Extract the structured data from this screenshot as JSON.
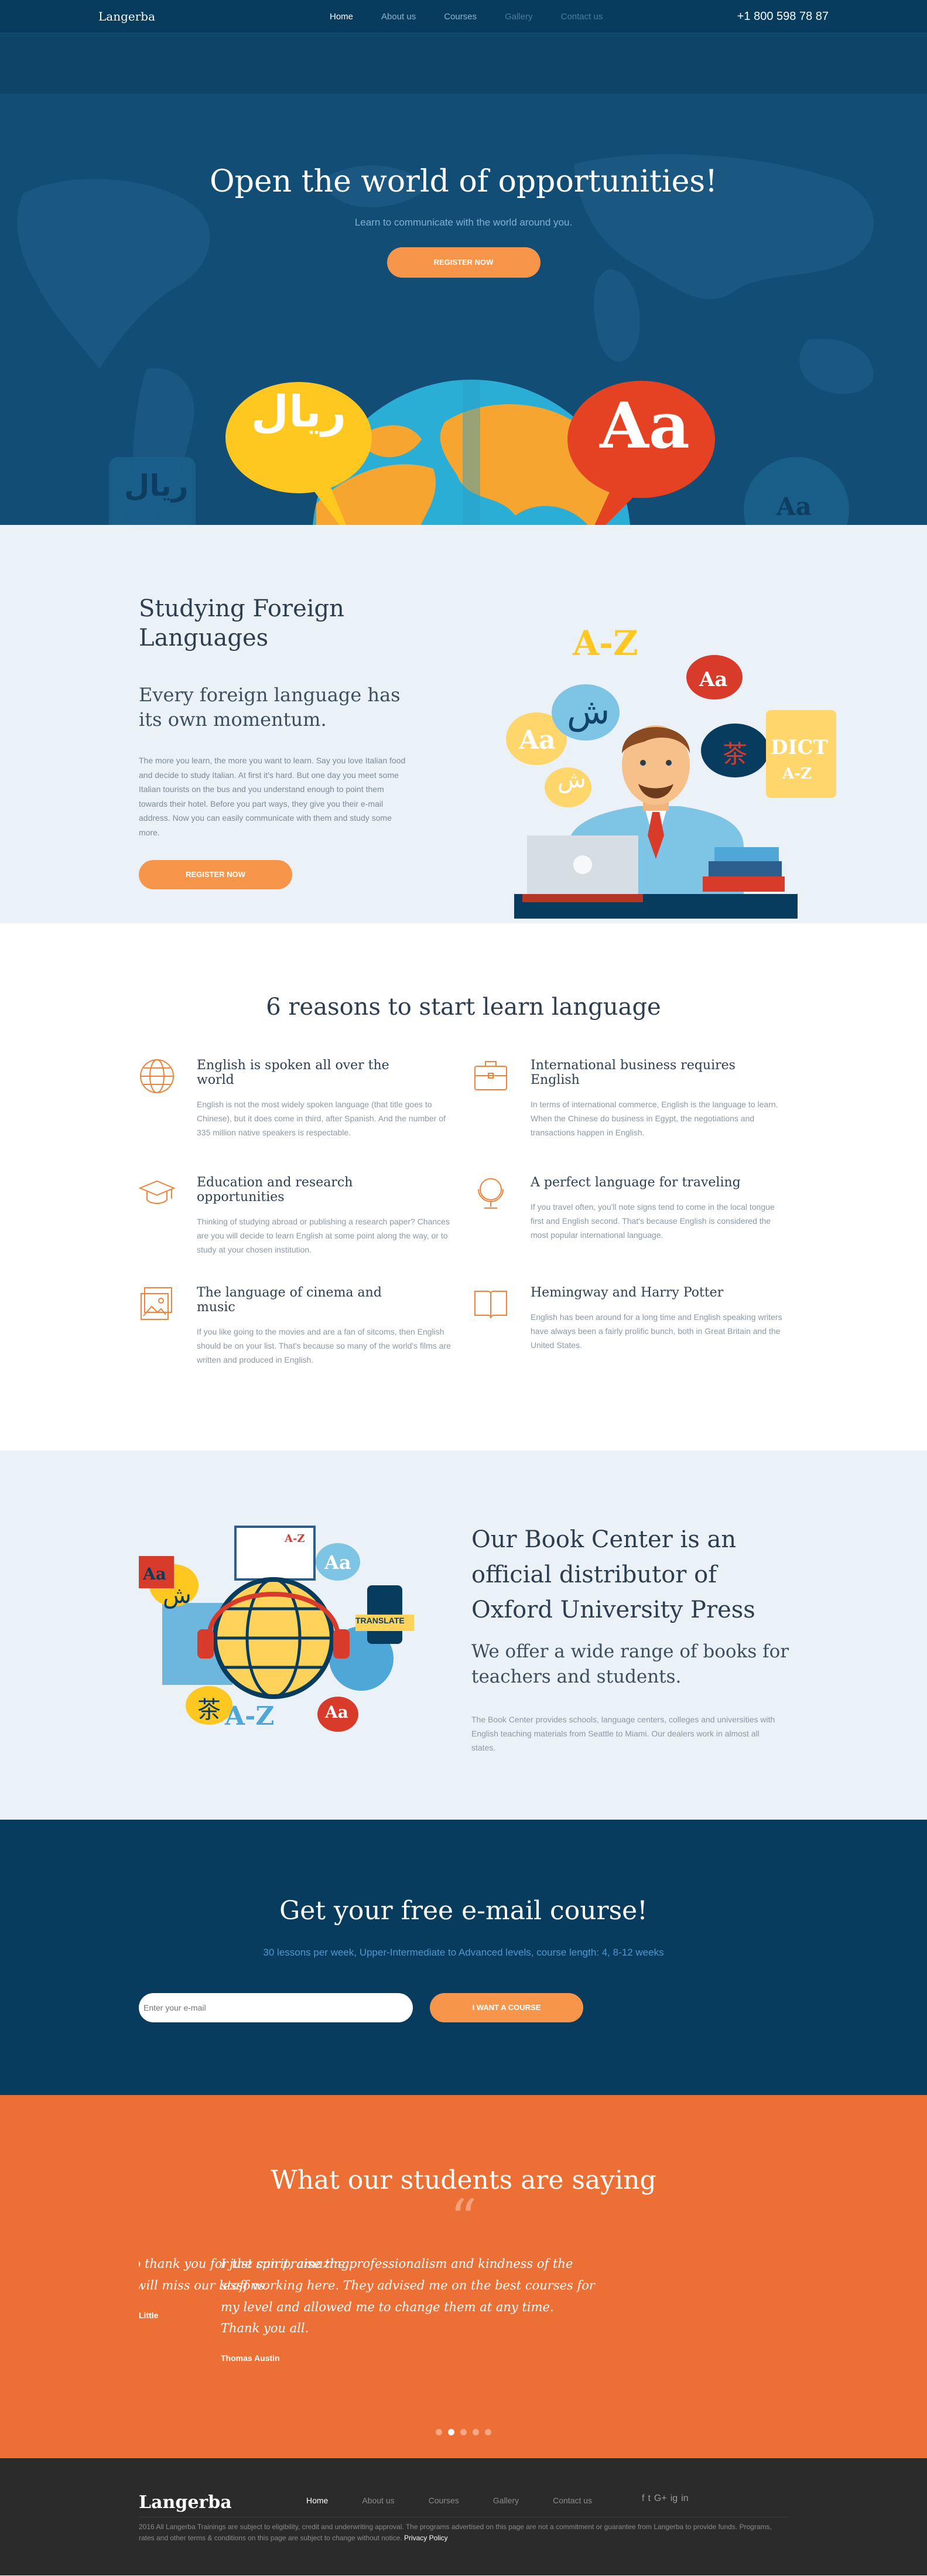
{
  "header": {
    "logo": "Langerba",
    "nav": [
      "Home",
      "About us",
      "Courses",
      "Gallery",
      "Contact us"
    ],
    "phone": "+1 800 598 78 87"
  },
  "hero": {
    "title": "Open the world of opportunities!",
    "subtitle": "Learn to communicate with the world around you.",
    "button": "REGISTER NOW",
    "bubble_left": "ريال",
    "bubble_right": "Aa",
    "bg_glyph_left": "ريال",
    "bg_glyph_right": "Aa"
  },
  "study": {
    "title": "Studying Foreign Languages",
    "subtitle": "Every foreign language has its own momentum.",
    "text": "The more you learn, the more you want to learn. Say you love Italian food and decide to study Italian. At first it's hard. But one day you meet some Italian tourists on the bus and you understand enough to point them towards their hotel. Before you part ways, they give you their e-mail address. Now you can easily communicate with them and study some more.",
    "button": "REGISTER NOW",
    "art_labels": {
      "az": "A-Z",
      "aa_red": "Aa",
      "aa_yellow": "Aa",
      "arabic": "ش",
      "arabic2": "ش",
      "chinese": "茶",
      "dict": "DICT",
      "dict_az": "A-Z"
    }
  },
  "reasons": {
    "title": "6 reasons to start learn language",
    "items": [
      {
        "icon": "globe-icon",
        "title": "English is spoken all over the world",
        "text": "English is not the most widely spoken language (that title goes to Chinese), but it does come in third, after Spanish. And the number of 335 million native speakers is respectable."
      },
      {
        "icon": "briefcase-icon",
        "title": "International business requires English",
        "text": "In terms of international commerce, English is the language to learn. When the Chinese do business in Egypt, the negotiations and transactions happen in English."
      },
      {
        "icon": "graduation-cap-icon",
        "title": "Education and research opportunities",
        "text": "Thinking of studying abroad or publishing a research paper? Chances are you will decide to learn English at some point along the way, or to study at your chosen institution."
      },
      {
        "icon": "globe-stand-icon",
        "title": "A perfect language for traveling",
        "text": "If you travel often, you'll note signs tend to come in the local tongue first and English second. That's because English is considered the most popular international language."
      },
      {
        "icon": "picture-icon",
        "title": "The language of cinema and music",
        "text": "If you like going to the movies and are a fan of sitcoms, then English should be on your list. That's because so many of the world's films are written and produced in English."
      },
      {
        "icon": "open-book-icon",
        "title": "Hemingway and Harry Potter",
        "text": "English has been around for a long time and English speaking writers have always been a fairly prolific bunch, both in Great Britain and the United States."
      }
    ]
  },
  "book": {
    "title": "Our Book Center is an official distributor of Oxford University Press",
    "subtitle": "We offer a wide range of books for teachers and students.",
    "text": "The Book Center provides schools, language centers, colleges and universities with English teaching materials from Seattle to Miami. Our dealers work in almost all states.",
    "art_labels": {
      "aa_top": "Aa",
      "aa_red": "Aa",
      "arabic": "ش",
      "az": "A-Z",
      "az_bottom": "A-Z",
      "translate": "TRANSLATE",
      "chinese": "茶",
      "aa_bottom": "Aa"
    }
  },
  "email": {
    "title": "Get your free e-mail course!",
    "subtitle": "30 lessons per week, Upper-Intermediate to Advanced levels, course length: 4, 8-12 weeks",
    "placeholder": "Enter your e-mail",
    "button": "I WANT A COURSE"
  },
  "testimonials": {
    "title": "What our students are saying",
    "quote_mark": "“",
    "slides": [
      {
        "text": "Langerba! I would like to thank you for the spirit, amazing team and atmosphere. I will miss our lessons.",
        "author": "Little"
      },
      {
        "text": "I just can praise the professionalism and kindness of the staff working here. They advised me on the best courses for my level and allowed me to change them at any time. Thank you all.",
        "author": "Thomas Austin"
      }
    ],
    "dots": 5,
    "active_dot": 1
  },
  "footer": {
    "logo": "Langerba",
    "nav": [
      "Home",
      "About us",
      "Courses",
      "Gallery",
      "Contact us"
    ],
    "social": [
      "f",
      "t",
      "G+",
      "ig",
      "in"
    ],
    "copyright": "2016 All Langerba Trainings are subject to eligibility, credit and underwriting approval. The programs advertised on this page are not a commitment or guarantee from Langerba to provide funds. Programs, rates and other terms & conditions on this page are subject to change without notice.",
    "privacy": "Privacy Policy"
  },
  "colors": {
    "navy": "#083c5f",
    "hero_blue": "#124d75",
    "orange": "#f7964a",
    "testimonial_orange": "#ec6f35",
    "light_bg": "#eaf1f7",
    "footer": "#2b2b2b"
  }
}
